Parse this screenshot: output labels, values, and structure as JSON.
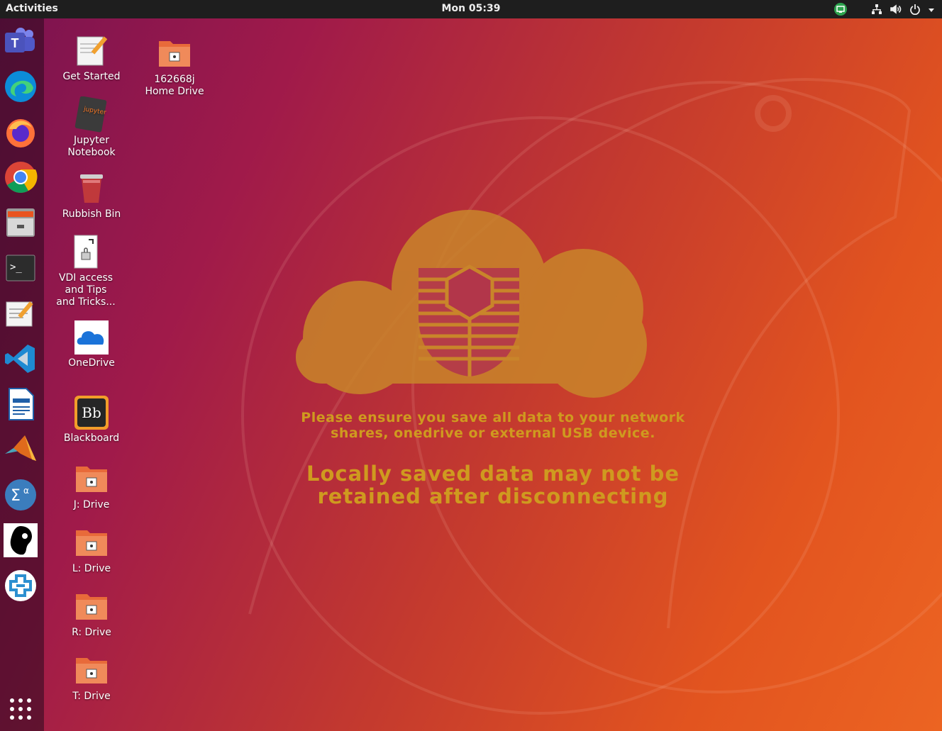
{
  "topbar": {
    "activities": "Activities",
    "clock": "Mon 05:39",
    "icons": [
      "remote-desktop-icon",
      "network-icon",
      "volume-icon",
      "power-icon",
      "chevron-down-icon"
    ]
  },
  "dock": {
    "items": [
      "Microsoft Teams",
      "Microsoft Edge",
      "Firefox",
      "Google Chrome",
      "Files",
      "Terminal",
      "Text Editor",
      "Visual Studio Code",
      "LibreOffice Writer",
      "MATLAB",
      "Maxima",
      "Inkscape",
      "Citrix Workspace"
    ],
    "show_apps": "Show Applications"
  },
  "desktop": {
    "icons": {
      "get_started": "Get Started",
      "home_drive": "162668j\nHome Drive",
      "jupyter": "Jupyter\nNotebook",
      "rubbish": "Rubbish Bin",
      "vdi": "VDI access\nand Tips\nand Tricks...",
      "onedrive": "OneDrive",
      "blackboard": "Blackboard",
      "j_drive": "J: Drive",
      "l_drive": "L: Drive",
      "r_drive": "R: Drive",
      "t_drive": "T: Drive"
    }
  },
  "wallpaper": {
    "message_line1": "Please ensure you save all data to your network\nshares, onedrive or external USB device.",
    "message_line2": "Locally saved data may not be\nretained after disconnecting"
  },
  "colors": {
    "topbar": "#1e1e1e",
    "accent": "#e95420",
    "notice": "#cf9a1f"
  }
}
